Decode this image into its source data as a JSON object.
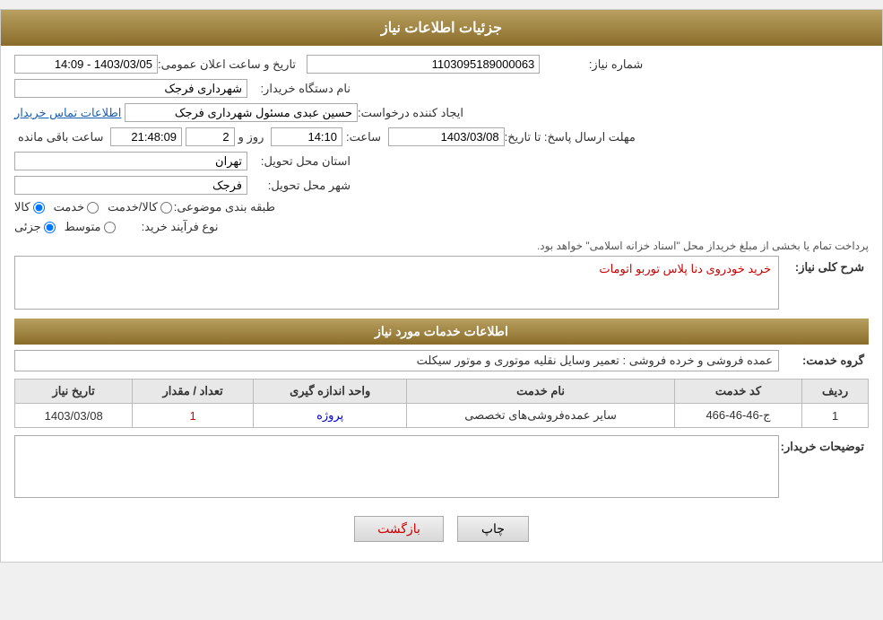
{
  "header": {
    "title": "جزئیات اطلاعات نیاز"
  },
  "fields": {
    "need_number_label": "شماره نیاز:",
    "need_number_value": "1103095189000063",
    "announce_date_label": "تاریخ و ساعت اعلان عمومی:",
    "announce_date_value": "1403/03/05 - 14:09",
    "buyer_org_label": "نام دستگاه خریدار:",
    "buyer_org_value": "شهرداری فرجک",
    "creator_label": "ایجاد کننده درخواست:",
    "creator_value": "حسین عبدی مسئول شهرداری فرجک",
    "creator_link": "اطلاعات تماس خریدار",
    "deadline_label": "مهلت ارسال پاسخ: تا تاریخ:",
    "deadline_date": "1403/03/08",
    "deadline_time_label": "ساعت:",
    "deadline_time": "14:10",
    "deadline_days_label": "روز و",
    "deadline_days": "2",
    "deadline_remaining_label": "ساعت باقی مانده",
    "deadline_remaining": "21:48:09",
    "province_label": "استان محل تحویل:",
    "province_value": "تهران",
    "city_label": "شهر محل تحویل:",
    "city_value": "فرجک",
    "category_label": "طبقه بندی موضوعی:",
    "category_kala": "کالا",
    "category_khadamat": "خدمت",
    "category_kala_khadamat": "کالا/خدمت",
    "process_label": "نوع فرآیند خرید:",
    "process_jozi": "جزئی",
    "process_mottavaset": "متوسط",
    "process_text": "پرداخت تمام یا بخشی از مبلغ خریداز محل \"اسناد خزانه اسلامی\" خواهد بود.",
    "description_label": "شرح کلی نیاز:",
    "description_value": "خرید خودروی دنا پلاس توربو اتومات"
  },
  "service_section": {
    "title": "اطلاعات خدمات مورد نیاز",
    "group_label": "گروه خدمت:",
    "group_value": "عمده فروشی و خرده فروشی : تعمیر وسایل نقلیه موتوری و موتور سیکلت"
  },
  "table": {
    "columns": [
      "ردیف",
      "کد خدمت",
      "نام خدمت",
      "واحد اندازه گیری",
      "تعداد / مقدار",
      "تاریخ نیاز"
    ],
    "rows": [
      {
        "row": "1",
        "code": "ج-46-46-466",
        "name": "سایر عمده‌فروشی‌های تخصصی",
        "unit": "پروژه",
        "quantity": "1",
        "date": "1403/03/08"
      }
    ]
  },
  "comments": {
    "label": "توضیحات خریدار:",
    "value": ""
  },
  "buttons": {
    "print": "چاپ",
    "back": "بازگشت"
  }
}
